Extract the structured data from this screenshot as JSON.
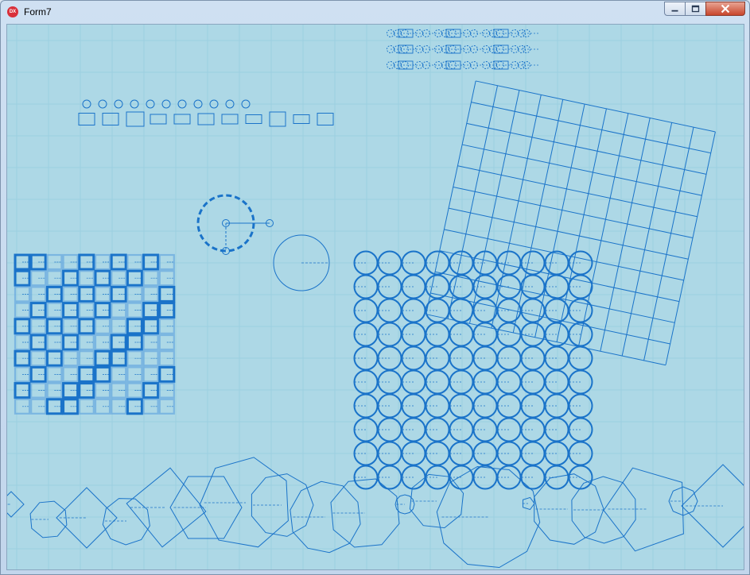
{
  "window": {
    "title": "Form7",
    "app_icon_text": "DX",
    "controls": {
      "minimize": "minimize",
      "maximize": "maximize",
      "close": "close"
    }
  },
  "canvas": {
    "background": "#add8e6",
    "grid_color": "#9ccfe0",
    "stroke_color": "#1a73c9",
    "light_stroke": "#5aa0dd"
  }
}
